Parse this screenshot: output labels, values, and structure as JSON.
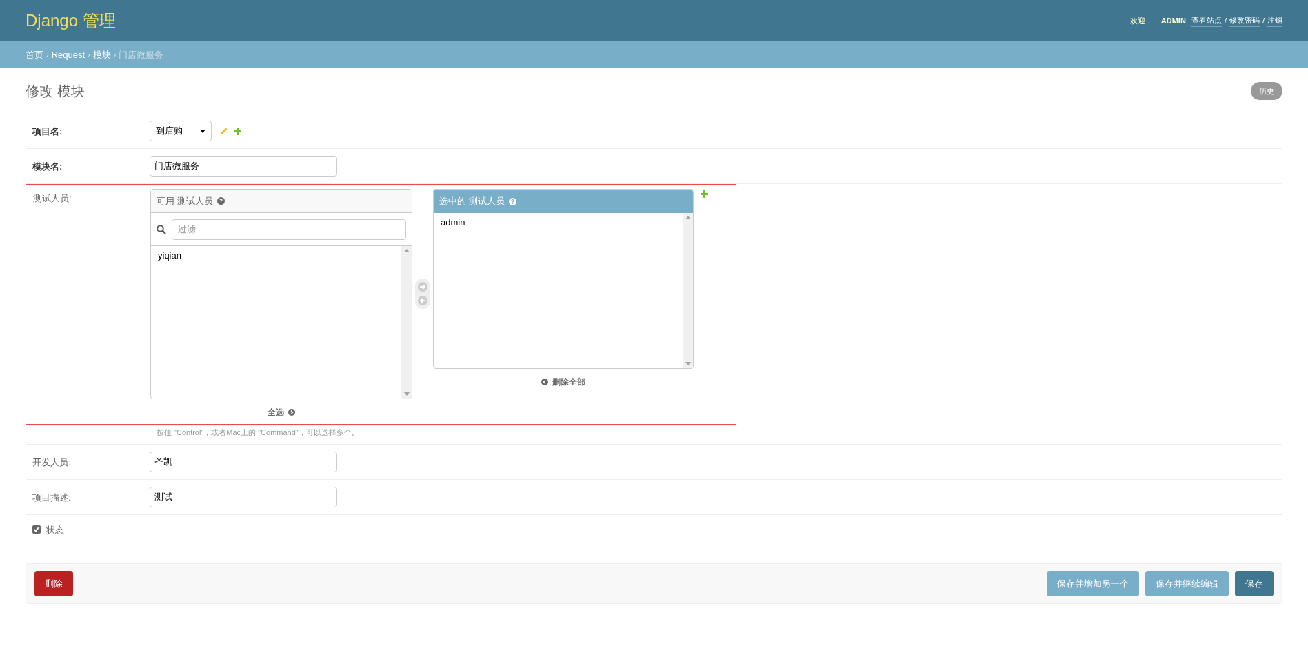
{
  "header": {
    "brand": "Django 管理",
    "welcome": "欢迎，",
    "user": "ADMIN",
    "links": [
      "查看站点",
      "修改密码",
      "注销"
    ],
    "link_separator": "/"
  },
  "breadcrumb_separator": "›",
  "breadcrumbs": [
    {
      "label": "首页",
      "current": false
    },
    {
      "label": "Request",
      "current": false
    },
    {
      "label": "模块",
      "current": false
    },
    {
      "label": "门店微服务",
      "current": true
    }
  ],
  "page": {
    "title": "修改 模块",
    "history_button": "历史"
  },
  "fields": [
    {
      "kind": "select",
      "label": "项目名:",
      "required": true,
      "value": "到店购"
    },
    {
      "kind": "text",
      "label": "模块名:",
      "required": true,
      "value": "门店微服务"
    },
    {
      "kind": "selector",
      "label": "测试人员:",
      "required": false,
      "highlighted": true,
      "available_title": "可用 测试人员",
      "filter_placeholder": "过滤",
      "available": [
        "yiqian"
      ],
      "choose_all": "全选",
      "chosen_title": "选中的 测试人员",
      "chosen": [
        "admin"
      ],
      "remove_all": "删除全部",
      "help": "按住 \"Control\"，或者Mac上的 \"Command\"，可以选择多个。"
    },
    {
      "kind": "text",
      "label": "开发人员:",
      "required": false,
      "value": "圣凯"
    },
    {
      "kind": "text",
      "label": "项目描述:",
      "required": false,
      "value": "测试"
    },
    {
      "kind": "checkbox",
      "label": "状态",
      "checked": true
    }
  ],
  "actions": {
    "delete": "删除",
    "buttons": [
      {
        "label": "保存并增加另一个",
        "primary": false
      },
      {
        "label": "保存并继续编辑",
        "primary": false
      },
      {
        "label": "保存",
        "primary": true
      }
    ]
  }
}
